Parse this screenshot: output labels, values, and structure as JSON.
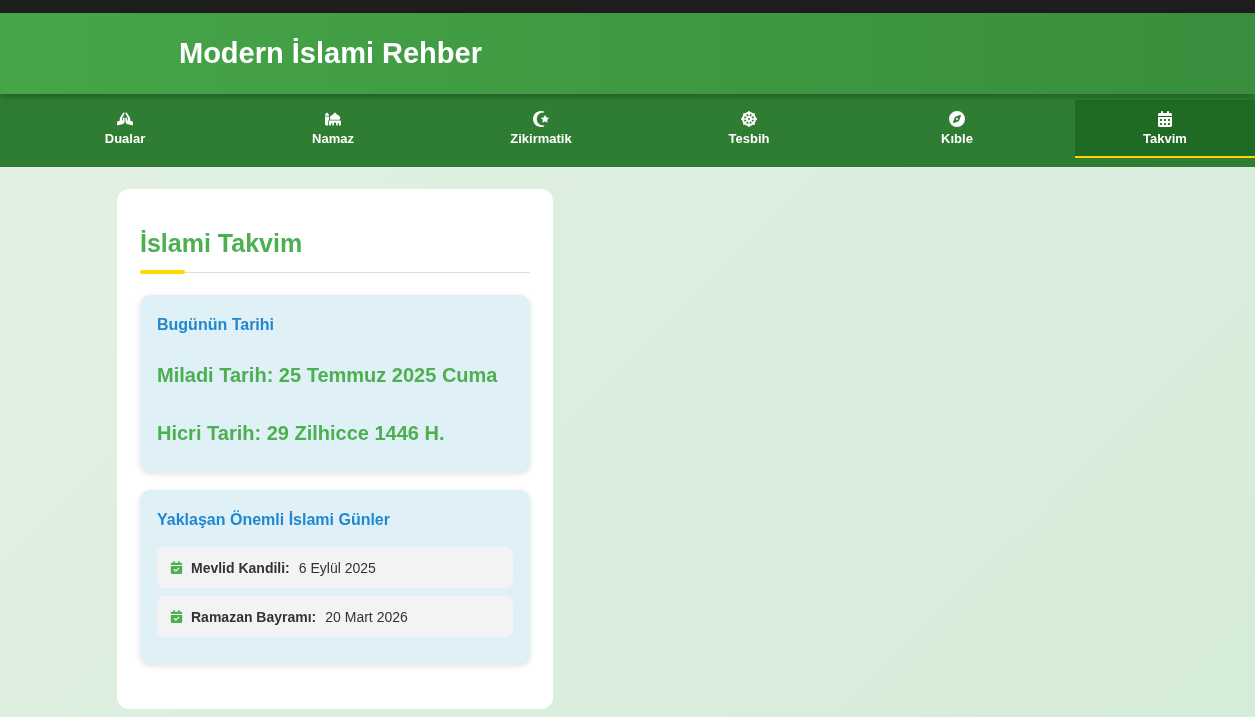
{
  "header": {
    "title": "Modern İslami Rehber"
  },
  "tabs": [
    {
      "label": "Dualar",
      "selected": false
    },
    {
      "label": "Namaz",
      "selected": false
    },
    {
      "label": "Zikirmatik",
      "selected": false
    },
    {
      "label": "Tesbih",
      "selected": false
    },
    {
      "label": "Kıble",
      "selected": false
    },
    {
      "label": "Takvim",
      "selected": true
    }
  ],
  "card": {
    "title": "İslami Takvim",
    "today": {
      "heading": "Bugünün Tarihi",
      "gregorian": "Miladi Tarih: 25 Temmuz 2025 Cuma",
      "hijri": "Hicri Tarih: 29 Zilhicce 1446 H."
    },
    "upcoming": {
      "heading": "Yaklaşan Önemli İslami Günler",
      "items": [
        {
          "name": "Mevlid Kandili:",
          "date": "6 Eylül 2025"
        },
        {
          "name": "Ramazan Bayramı:",
          "date": "20 Mart 2026"
        }
      ]
    }
  }
}
